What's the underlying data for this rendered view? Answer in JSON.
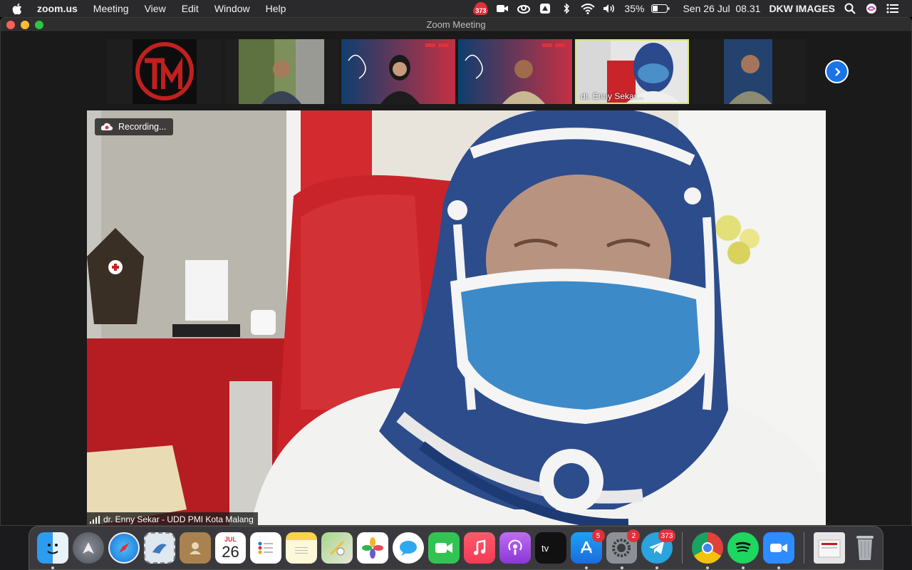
{
  "menubar": {
    "app": "zoom.us",
    "menus": [
      "Meeting",
      "View",
      "Edit",
      "Window",
      "Help"
    ],
    "status": {
      "notification_badge": "373",
      "battery": "35%",
      "datetime": "Sen 26 Jul  08.31",
      "user": "DKW IMAGES"
    }
  },
  "window": {
    "title": "Zoom Meeting"
  },
  "filmstrip": {
    "active_name": "dr. Enny Sekar..."
  },
  "main": {
    "recording_label": "Recording...",
    "speaker_name": "dr. Enny Sekar - UDD PMI Kota Malang"
  },
  "dock": {
    "calendar": {
      "month": "JUL",
      "day": "26"
    },
    "badges": {
      "app_store": "5",
      "system_prefs": "2",
      "telegram": "373"
    }
  },
  "colors": {
    "accent": "#1a74e8",
    "active_speaker": "#d8e46a",
    "recording_dot": "#e0313a"
  }
}
